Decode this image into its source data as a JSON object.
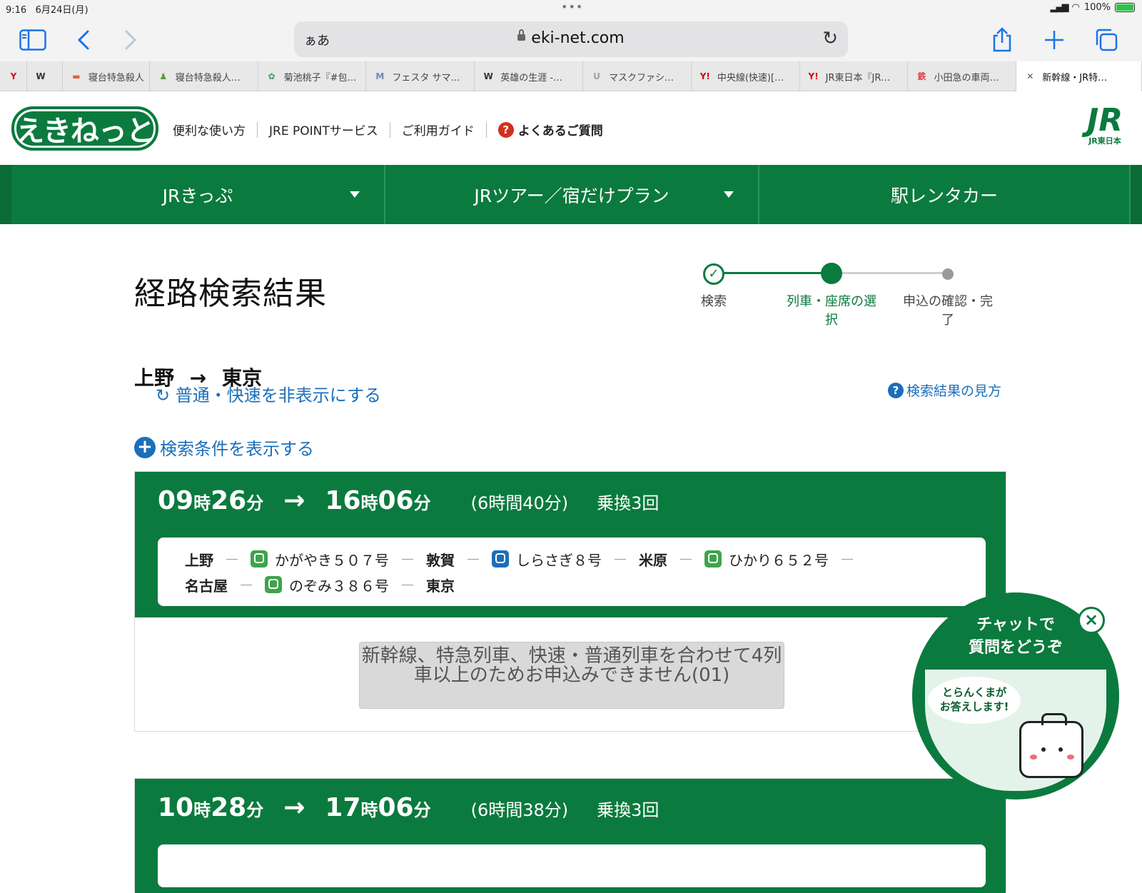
{
  "status_bar": {
    "time": "9:16",
    "date": "6月24日(月)",
    "battery": "100%"
  },
  "browser": {
    "text_size": "ぁあ",
    "domain": "eki-net.com",
    "tabs": [
      {
        "label": "",
        "fav": "Y",
        "fav_color": "#d0021b"
      },
      {
        "label": "",
        "fav": "W",
        "fav_color": "#333333"
      },
      {
        "label": "寝台特急殺人",
        "fav": "▬",
        "fav_color": "#e06040"
      },
      {
        "label": "寝台特急殺人…",
        "fav": "♟",
        "fav_color": "#5a9a3a"
      },
      {
        "label": "菊池桃子『#包…",
        "fav": "✿",
        "fav_color": "#3aa15a"
      },
      {
        "label": "フェスタ サマ…",
        "fav": "M",
        "fav_color": "#6a8ab0"
      },
      {
        "label": "英雄の生涯 -…",
        "fav": "W",
        "fav_color": "#333333"
      },
      {
        "label": "マスクファシ…",
        "fav": "U",
        "fav_color": "#9aa0b0"
      },
      {
        "label": "中央線(快速)[…",
        "fav": "Y!",
        "fav_color": "#d0021b"
      },
      {
        "label": "JR東日本『JR…",
        "fav": "Y!",
        "fav_color": "#d0021b"
      },
      {
        "label": "小田急の車両…",
        "fav": "鉄",
        "fav_color": "#e04040"
      },
      {
        "label": "新幹線・JR特…",
        "fav": "✕",
        "fav_color": "#555555"
      }
    ]
  },
  "header": {
    "logo": "えきねっと",
    "nav": [
      "便利な使い方",
      "JRE POINTサービス",
      "ご利用ガイド"
    ],
    "faq": "よくあるご質問",
    "jr_logo": "JR",
    "jr_sub": "JR東日本"
  },
  "main_nav": [
    {
      "label": "JRきっぷ",
      "dropdown": true
    },
    {
      "label": "JRツアー／宿だけプラン",
      "dropdown": true
    },
    {
      "label": "駅レンタカー",
      "dropdown": false
    }
  ],
  "page": {
    "title": "経路検索結果",
    "steps": [
      {
        "label": "検索",
        "state": "done"
      },
      {
        "label": "列車・座席の選択",
        "state": "current"
      },
      {
        "label": "申込の確認・完了",
        "state": "upcoming"
      }
    ],
    "from": "上野",
    "to": "東京",
    "arrow": "→",
    "hide_local": "普通・快速を非表示にする",
    "help_link": "検索結果の見方",
    "show_conditions": "検索条件を表示する"
  },
  "results": [
    {
      "dep_h": "09",
      "dep_m": "26",
      "arr_h": "16",
      "arr_m": "06",
      "unit_h": "時",
      "unit_m": "分",
      "duration": "(6時間40分)",
      "transfers": "乗換3回",
      "row1": [
        {
          "type": "station",
          "text": "上野"
        },
        {
          "type": "train",
          "text": "かがやき５０７号",
          "color": "green"
        },
        {
          "type": "station",
          "text": "敦賀"
        },
        {
          "type": "train",
          "text": "しらさぎ８号",
          "color": "blue"
        },
        {
          "type": "station",
          "text": "米原"
        },
        {
          "type": "train",
          "text": "ひかり６５２号",
          "color": "green"
        }
      ],
      "row2": [
        {
          "type": "station",
          "text": "名古屋"
        },
        {
          "type": "train",
          "text": "のぞみ３８６号",
          "color": "green"
        },
        {
          "type": "station",
          "text": "東京"
        }
      ],
      "error": "新幹線、特急列車、快速・普通列車を合わせて4列車以上のためお申込みできません(01)"
    },
    {
      "dep_h": "10",
      "dep_m": "28",
      "arr_h": "17",
      "arr_m": "06",
      "unit_h": "時",
      "unit_m": "分",
      "duration": "(6時間38分)",
      "transfers": "乗換3回"
    }
  ],
  "chat": {
    "title_line1": "チャットで",
    "title_line2": "質問をどうぞ",
    "bubble_line1": "とらんくまが",
    "bubble_line2": "お答えします!",
    "close": "×"
  }
}
